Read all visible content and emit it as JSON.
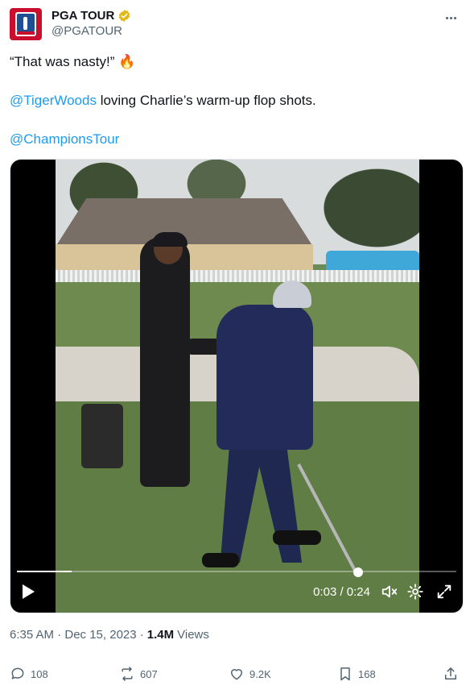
{
  "author": {
    "display_name": "PGA TOUR",
    "handle": "@PGATOUR",
    "verified": true,
    "avatar_icon": "pga-tour-logo"
  },
  "tweet": {
    "line1": "“That was nasty!” 🔥",
    "mention1": "@TigerWoods",
    "line2_rest": " loving Charlie’s warm-up flop shots.",
    "mention2": "@ChampionsTour"
  },
  "video": {
    "current_time": "0:03",
    "duration": "0:24",
    "time_display": "0:03 / 0:24",
    "progress_fraction": 0.125
  },
  "meta": {
    "timestamp": "6:35 AM · Dec 15, 2023 · ",
    "views_count": "1.4M",
    "views_label": "Views"
  },
  "actions": {
    "replies": "108",
    "reposts": "607",
    "likes": "9.2K",
    "bookmarks": "168"
  },
  "colors": {
    "accent": "#1d9bf0",
    "verified_badge": "#e2b719",
    "muted_text": "#536471"
  }
}
